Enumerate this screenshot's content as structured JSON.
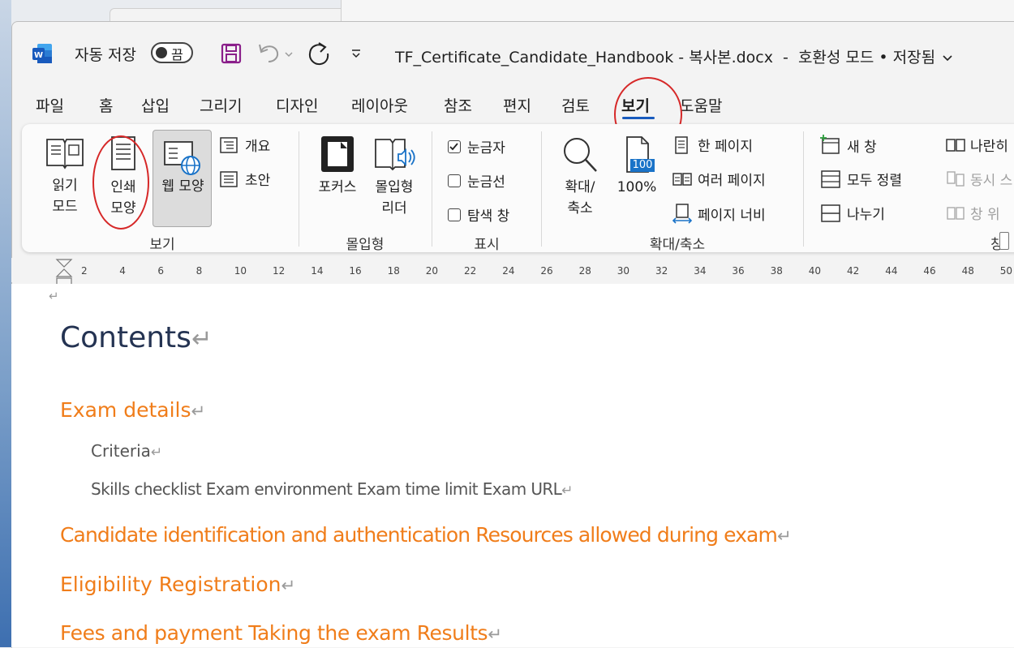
{
  "titlebar": {
    "autosave_label": "자동 저장",
    "autosave_state": "끔",
    "document_title": "TF_Certificate_Candidate_Handbook - 복사본.docx",
    "title_separator": "-",
    "mode_text": "호환성 모드 • 저장됨"
  },
  "tabs": [
    "파일",
    "홈",
    "삽입",
    "그리기",
    "디자인",
    "레이아웃",
    "참조",
    "편지",
    "검토",
    "보기",
    "도움말"
  ],
  "active_tab": "보기",
  "ribbon": {
    "views": {
      "reading_mode": [
        "읽기",
        "모드"
      ],
      "print_layout": [
        "인쇄",
        "모양"
      ],
      "web_layout": "웹 모양",
      "outline": "개요",
      "draft": "초안",
      "group_label": "보기"
    },
    "immersive": {
      "focus": "포커스",
      "immersive_reader": [
        "몰입형",
        "리더"
      ],
      "group_label": "몰입형"
    },
    "show": {
      "ruler": "눈금자",
      "ruler_checked": true,
      "gridlines": "눈금선",
      "gridlines_checked": false,
      "nav_pane": "탐색 창",
      "nav_pane_checked": false,
      "group_label": "표시"
    },
    "zoom": {
      "zoom": [
        "확대/",
        "축소"
      ],
      "hundred": "100%",
      "hundred_badge": "100",
      "one_page": "한 페이지",
      "multiple_pages": "여러 페이지",
      "page_width": "페이지 너비",
      "group_label": "확대/축소"
    },
    "window": {
      "new_window": "새 창",
      "arrange_all": "모두 정렬",
      "split": "나누기",
      "side_by_side": "나란히",
      "sync_scroll": "동시 스",
      "reset_position": "창 위",
      "group_label": "창"
    }
  },
  "ruler_ticks": [
    "2",
    "4",
    "6",
    "8",
    "10",
    "12",
    "14",
    "16",
    "18",
    "20",
    "22",
    "24",
    "26",
    "28",
    "30",
    "32",
    "34",
    "36",
    "38",
    "40",
    "42",
    "44",
    "46",
    "48",
    "50"
  ],
  "document": {
    "title": "Contents",
    "entries": [
      {
        "level": 1,
        "text": "Exam details"
      },
      {
        "level": 2,
        "text": "Criteria"
      },
      {
        "level": 2,
        "text": "Skills checklist Exam environment Exam time limit Exam URL"
      },
      {
        "level": 1,
        "text": "Candidate identification and authentication Resources allowed during exam"
      },
      {
        "level": 1,
        "text": "Eligibility Registration"
      },
      {
        "level": 1,
        "text": "Fees and payment Taking the exam Results"
      }
    ],
    "paragraph_mark": "↵"
  },
  "colors": {
    "heading_orange": "#f07d1a",
    "title_navy": "#243352",
    "word_blue": "#185abd",
    "save_purple": "#8a1f8a",
    "annotation_red": "#d62828"
  }
}
